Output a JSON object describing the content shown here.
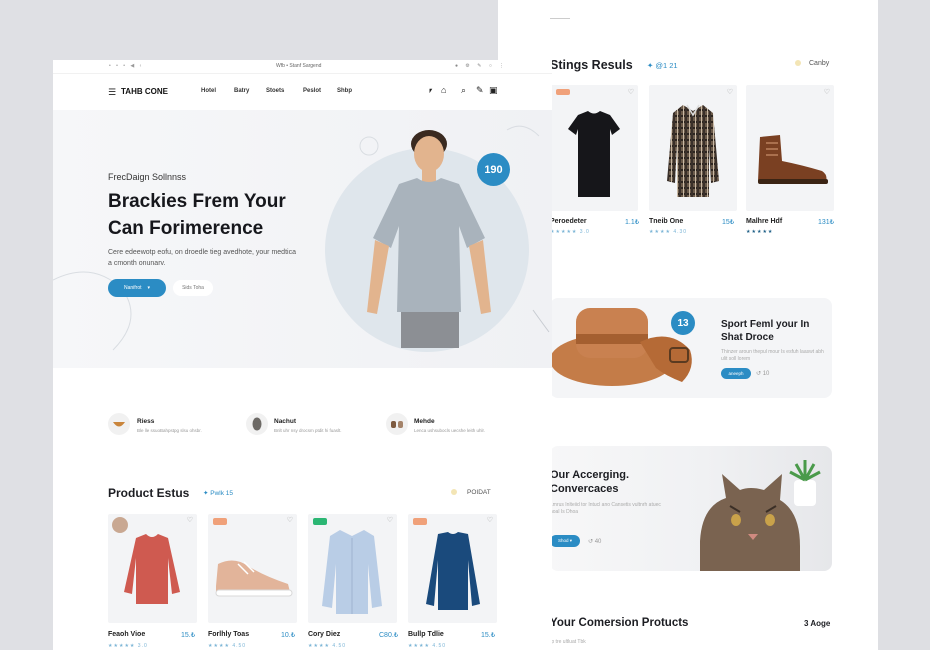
{
  "search_results": {
    "title": "Stings Resuls",
    "subtitle": "✦ @1 21",
    "sort_label": "Canby",
    "products": [
      {
        "name": "Peroedeter",
        "price": "1.1₺",
        "stars": "★★★★★ 3.0"
      },
      {
        "name": "Tneib One",
        "price": "15₺",
        "stars": "★★★★ 4.30"
      },
      {
        "name": "Malhre Hdf",
        "price": "131₺",
        "stars": "★★★★★"
      }
    ]
  },
  "promo": {
    "badge": "13",
    "title": "Sport Feml your In Shat Droce",
    "desc": "Thinzer aroun thepul mour Is esfuh laaswt abh ulit soll lorem",
    "button": "aneeph",
    "extra": "↺ 10"
  },
  "cat_banner": {
    "title": "Our Accerging. Convercaces",
    "desc": "Lmrus Inlteiid tor Intucl ano Cansetis vultnrh atuec hoal Is Dhoa",
    "button": "Shod ▾",
    "extra": "↺ 40"
  },
  "conversion": {
    "title": "Your Comersion Protucts",
    "right": "3 Aoge",
    "sub": "Ip tre ultluat Tbk"
  },
  "browser": {
    "left": "• • •  ◀  ‹",
    "url": "Wfb • Stanf Sargend",
    "right": "● ⚙ ✎ ○ ⋮"
  },
  "nav": {
    "logo": "TAHB CONE",
    "items": [
      "Hotel",
      "Batry",
      "Stoets",
      "Peslot",
      "Shbp"
    ],
    "icons": [
      "⎖",
      "⌂",
      "⌕",
      "✎",
      "▣"
    ]
  },
  "hero": {
    "kicker": "FrecDaign Sollnnss",
    "title": "Brackies Frem Your Can Forimerence",
    "desc": "Cere edeewotp eofu, on droedle tieg avedhote, your medtica a cmonth onunarv.",
    "primary_button": "Nanifrot",
    "secondary_button": "Sids Toha",
    "badge": "190"
  },
  "features": [
    {
      "title": "Riess",
      "desc": "Ble lle ssuoBahpstpg slsu ohsbr."
    },
    {
      "title": "Nachut",
      "desc": "Bnlt uhr nsy drocsm ptdit hi fuaslt."
    },
    {
      "title": "Mehde",
      "desc": "Lenca ushsubocls uecshe leith uhlr."
    }
  ],
  "product_section": {
    "title": "Product Estus",
    "subtitle": "✦ Pwlk 15",
    "sort_label": "POIDAT"
  },
  "products": [
    {
      "name": "Feaoh Vioe",
      "price": "15.₺",
      "stars": "★★★★★ 3.0",
      "tag_color": "#f0a17a"
    },
    {
      "name": "Forlhly Toas",
      "price": "10.₺",
      "stars": "★★★★ 4.50",
      "tag_color": "#f0a17a"
    },
    {
      "name": "Cory Diez",
      "price": "C80.₺",
      "stars": "★★★★ 4.50",
      "tag_color": "#2bb673"
    },
    {
      "name": "Bullp Tdlie",
      "price": "15.₺",
      "stars": "★★★★ 4.50",
      "tag_color": "#f0a17a"
    }
  ],
  "colors": {
    "accent": "#2b8cc4"
  }
}
